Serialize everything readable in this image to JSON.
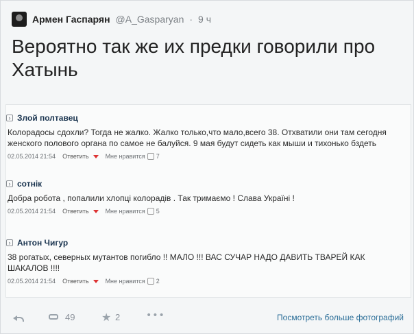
{
  "tweet": {
    "author_name": "Армен Гаспарян",
    "handle": "@A_Gasparyan",
    "dot": "·",
    "time_ago": "9 ч",
    "text_line1": "Вероятно так же их предки говорили про",
    "text_line2": "Хатынь",
    "comments": [
      {
        "author": "Злой полтавец",
        "text": "Колорадосы сдохли? Тогда не жалко. Жалко только,что мало,всего 38. Отхватили они там сегодня женского полового органа по самое не балуйся. 9 мая будут сидеть как мыши и тихонько бздеть",
        "date": "02.05.2014 21:54",
        "reply_label": "Ответить",
        "like_label": "Мне нравится",
        "like_count": "7"
      },
      {
        "author": "сотнік",
        "text": "Добра робота , попалили хлопці колорадів . Так тримаємо ! Слава Україні !",
        "date": "02.05.2014 21:54",
        "reply_label": "Ответить",
        "like_label": "Мне нравится",
        "like_count": "5"
      },
      {
        "author": "Антон Чигур",
        "text": "38 рогатых, северных мутантов погибло !! МАЛО !!! ВАС СУЧАР НАДО ДАВИТЬ ТВАРЕЙ КАК ШАКАЛОВ !!!!",
        "date": "02.05.2014 21:54",
        "reply_label": "Ответить",
        "like_label": "Мне нравится",
        "like_count": "2"
      }
    ]
  },
  "actions": {
    "retweet_count": "49",
    "favorite_count": "2"
  },
  "footer": {
    "see_more": "Посмотреть больше фотографий"
  }
}
